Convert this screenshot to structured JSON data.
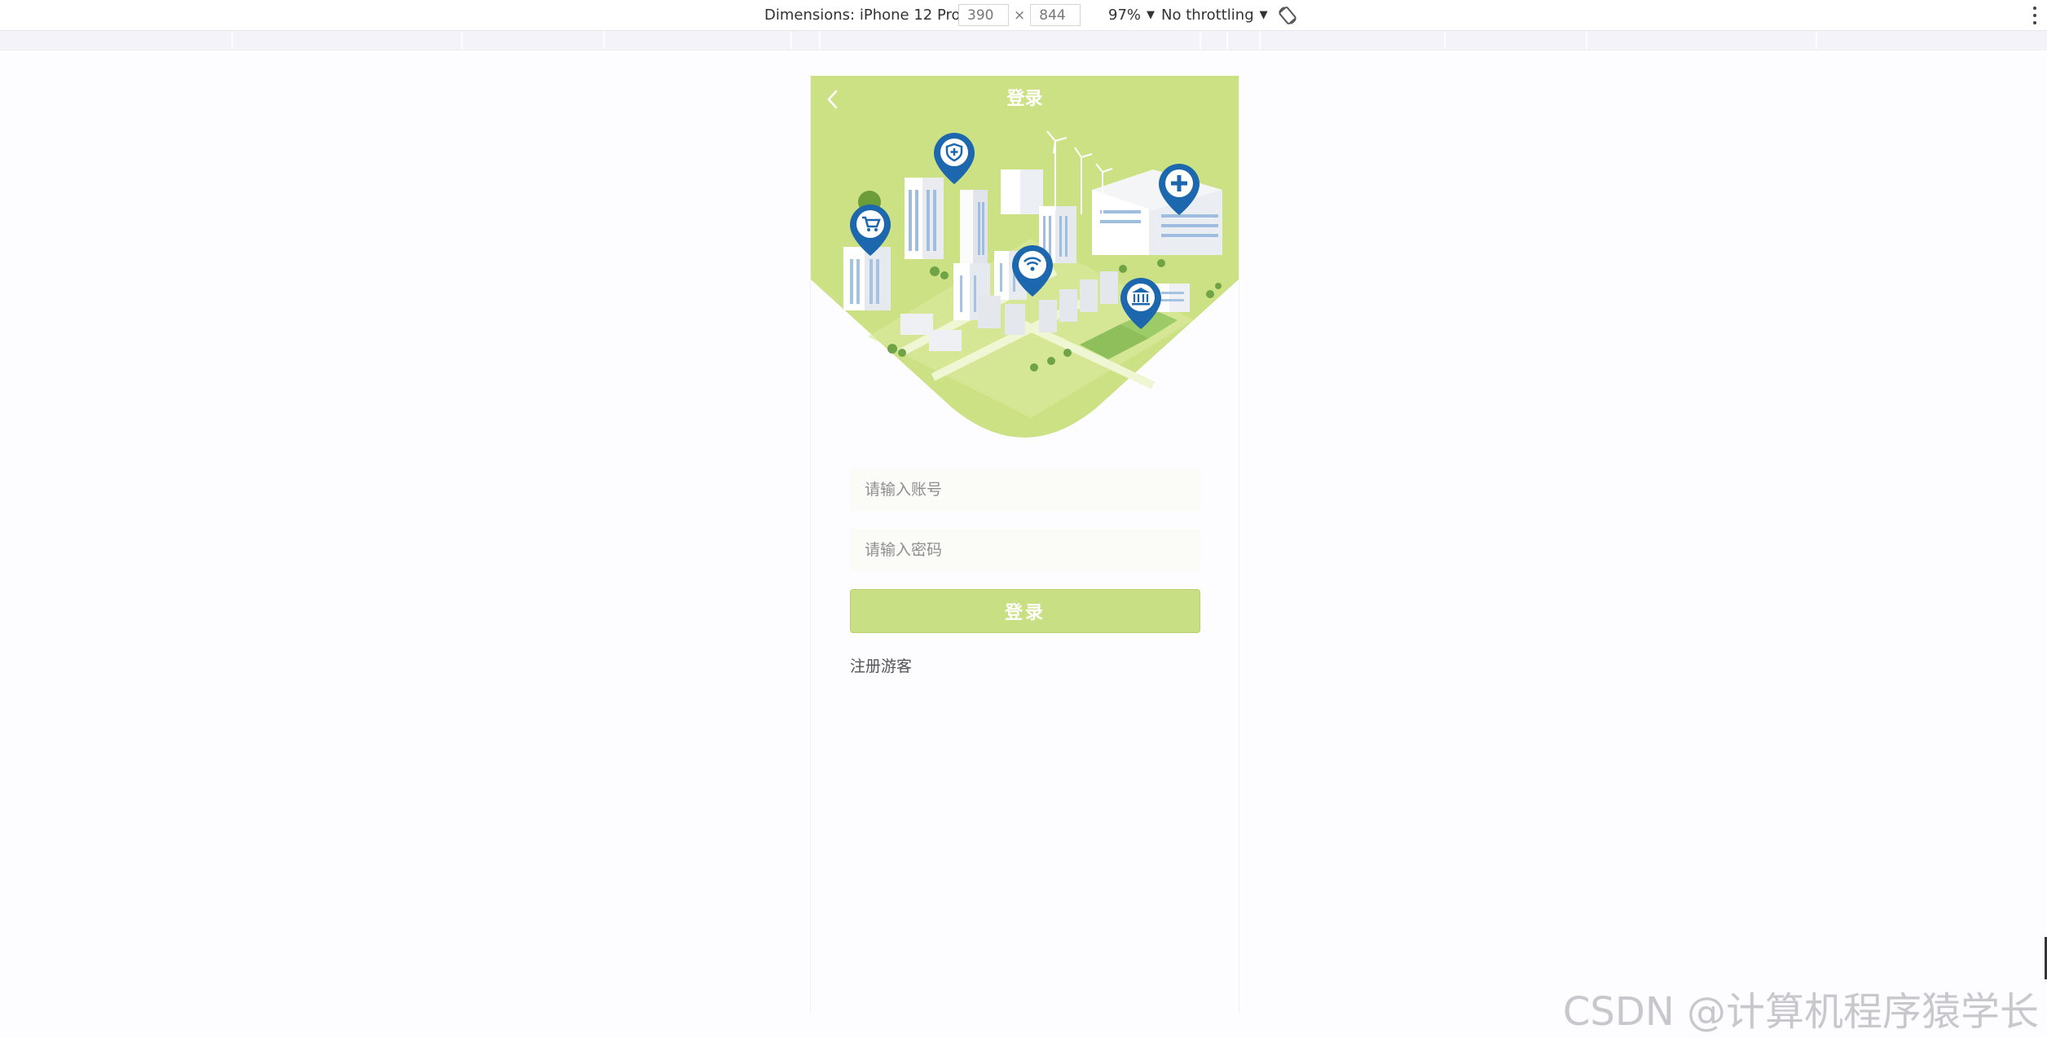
{
  "devtools": {
    "dimensions_label": "Dimensions: iPhone 12 Pro",
    "width_value": "390",
    "times": "×",
    "height_value": "844",
    "zoom": "97%",
    "throttling": "No throttling"
  },
  "app": {
    "title": "登录",
    "username_placeholder": "请输入账号",
    "password_placeholder": "请输入密码",
    "login_button": "登录",
    "register_link": "注册游客"
  },
  "watermark": "CSDN @计算机程序猿学长",
  "colors": {
    "hero_green": "#cbe184",
    "button_green": "#c9df83",
    "pin_blue": "#1c67ae"
  },
  "icons": [
    "chevron-left-icon",
    "caret-down-icon",
    "rotate-icon",
    "more-vert-icon",
    "shield-pin-icon",
    "cart-pin-icon",
    "wifi-pin-icon",
    "hospital-pin-icon",
    "bank-pin-icon"
  ]
}
